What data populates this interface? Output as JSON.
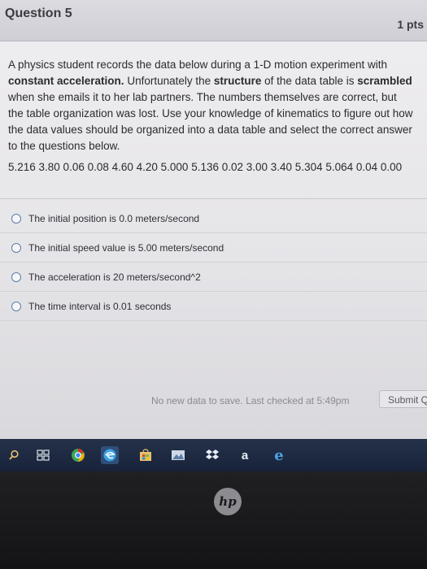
{
  "question": {
    "title": "Question 5",
    "points": "1 pts",
    "body": [
      {
        "text": "A physics student records the data below during a 1-D motion experiment with ",
        "bold": false
      },
      {
        "text": "constant acceleration.",
        "bold": true
      },
      {
        "text": " Unfortunately the ",
        "bold": false
      },
      {
        "text": "structure",
        "bold": true
      },
      {
        "text": " of the data table is ",
        "bold": false
      },
      {
        "text": "scrambled",
        "bold": true
      },
      {
        "text": " when she emails it to her lab partners. The numbers themselves are correct, but the table organization was lost. Use your knowledge of kinematics to figure out how the data values should be organized into a data table and select the correct answer to the questions below.",
        "bold": false
      }
    ],
    "data_values": "5.216 3.80 0.06 0.08 4.60 4.20 5.000 5.136 0.02 3.00 3.40 5.304 5.064 0.04 0.00"
  },
  "answers": [
    {
      "label": "The initial position is 0.0 meters/second"
    },
    {
      "label": "The initial speed value is 5.00 meters/second"
    },
    {
      "label": "The acceleration is 20 meters/second^2"
    },
    {
      "label": "The time interval is 0.01 seconds"
    }
  ],
  "footer": {
    "save_status": "No new data to save. Last checked at 5:49pm",
    "submit_label": "Submit Q"
  },
  "taskbar": {
    "icons": [
      "search-icon",
      "task-view-icon",
      "chrome-icon",
      "edge-icon",
      "store-icon",
      "photos-icon",
      "dropbox-icon",
      "amazon-icon",
      "ie-icon"
    ],
    "amazon_glyph": "a",
    "ie_glyph": "e"
  },
  "bezel": {
    "logo": "hp"
  },
  "colors": {
    "header_bg": "#d4d3d9",
    "page_bg": "#eaeaec",
    "text": "#2b2b30",
    "radio_border": "#5a7fa8",
    "taskbar_bg": "#1e2a42"
  }
}
